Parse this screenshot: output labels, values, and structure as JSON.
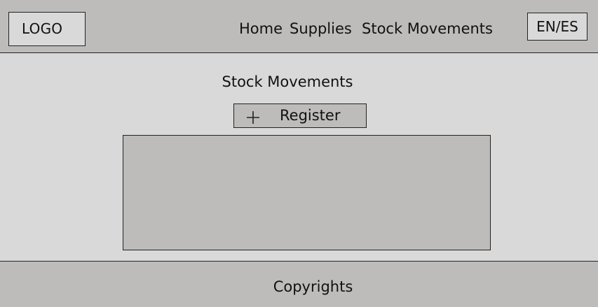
{
  "header": {
    "logo_label": "LOGO",
    "nav": {
      "home": "Home",
      "supplies": "Supplies",
      "stock_movements": "Stock Movements"
    },
    "language_toggle": "EN/ES"
  },
  "main": {
    "title": "Stock Movements",
    "register_button": {
      "icon": "plus-icon",
      "label": "Register"
    }
  },
  "footer": {
    "text": "Copyrights"
  },
  "colors": {
    "background": "#d9d9d9",
    "bars": "#bdbcbb",
    "border": "#222222"
  }
}
